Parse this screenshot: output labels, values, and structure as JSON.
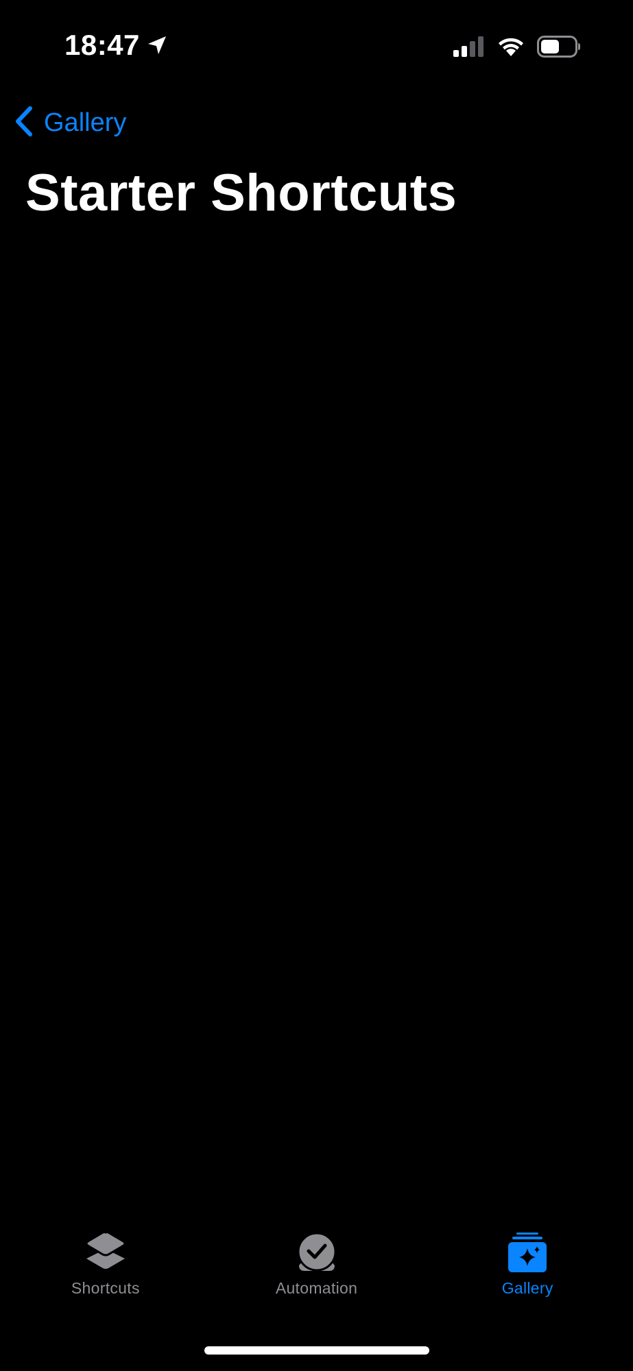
{
  "status_bar": {
    "time": "18:47",
    "icons": [
      "location-arrow-icon",
      "cellular-signal-icon",
      "wifi-icon",
      "battery-icon"
    ]
  },
  "nav": {
    "back_label": "Gallery",
    "title": "Starter Shortcuts"
  },
  "tab_bar": {
    "tabs": [
      {
        "label": "Shortcuts",
        "icon": "layers-icon",
        "active": false
      },
      {
        "label": "Automation",
        "icon": "checkmark-clock-icon",
        "active": false
      },
      {
        "label": "Gallery",
        "icon": "gallery-sparkle-icon",
        "active": true
      }
    ]
  },
  "colors": {
    "background": "#000000",
    "accent": "#0a84ff",
    "inactive": "#8e8e93",
    "text": "#ffffff"
  }
}
